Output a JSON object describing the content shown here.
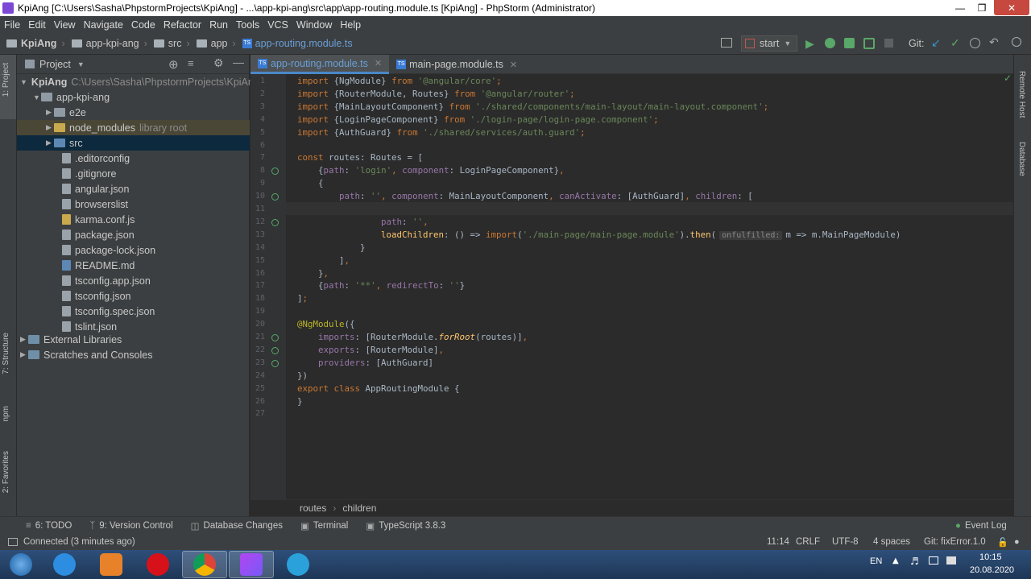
{
  "window": {
    "title": "KpiAng [C:\\Users\\Sasha\\PhpstormProjects\\KpiAng] - ...\\app-kpi-ang\\src\\app\\app-routing.module.ts [KpiAng] - PhpStorm (Administrator)"
  },
  "menu": [
    "File",
    "Edit",
    "View",
    "Navigate",
    "Code",
    "Refactor",
    "Run",
    "Tools",
    "VCS",
    "Window",
    "Help"
  ],
  "navbar": {
    "crumbs": [
      "KpiAng",
      "app-kpi-ang",
      "src",
      "app",
      "app-routing.module.ts"
    ],
    "run_config": "start",
    "git_label": "Git:"
  },
  "project_panel": {
    "title": "Project",
    "tree": [
      {
        "label": "KpiAng",
        "extra": "C:\\Users\\Sasha\\PhpstormProjects\\KpiAng"
      },
      {
        "label": "app-kpi-ang",
        "extra": ""
      },
      {
        "label": "e2e",
        "extra": ""
      },
      {
        "label": "node_modules",
        "extra": "library root"
      },
      {
        "label": "src",
        "extra": ""
      },
      {
        "label": ".editorconfig",
        "extra": ""
      },
      {
        "label": ".gitignore",
        "extra": ""
      },
      {
        "label": "angular.json",
        "extra": ""
      },
      {
        "label": "browserslist",
        "extra": ""
      },
      {
        "label": "karma.conf.js",
        "extra": ""
      },
      {
        "label": "package.json",
        "extra": ""
      },
      {
        "label": "package-lock.json",
        "extra": ""
      },
      {
        "label": "README.md",
        "extra": ""
      },
      {
        "label": "tsconfig.app.json",
        "extra": ""
      },
      {
        "label": "tsconfig.json",
        "extra": ""
      },
      {
        "label": "tsconfig.spec.json",
        "extra": ""
      },
      {
        "label": "tslint.json",
        "extra": ""
      },
      {
        "label": "External Libraries",
        "extra": ""
      },
      {
        "label": "Scratches and Consoles",
        "extra": ""
      }
    ]
  },
  "left_tool_tabs": [
    "1: Project",
    "7: Structure",
    "npm",
    "2: Favorites"
  ],
  "right_tool_tabs": [
    "Remote Host",
    "Database"
  ],
  "editor": {
    "tabs": [
      "app-routing.module.ts",
      "main-page.module.ts"
    ],
    "inlay_hint": "onfulfilled:",
    "breadcrumb": [
      "routes",
      "children"
    ]
  },
  "bottom_tools": [
    "6: TODO",
    "9: Version Control",
    "Database Changes",
    "Terminal",
    "TypeScript 3.8.3",
    "Event Log"
  ],
  "status": {
    "message": "Connected (3 minutes ago)",
    "position": "11:14",
    "line_sep": "CRLF",
    "encoding": "UTF-8",
    "indent": "4 spaces",
    "branch": "Git: fixError.1.0"
  },
  "taskbar": {
    "lang": "EN",
    "time": "10:15",
    "date": "20.08.2020"
  }
}
